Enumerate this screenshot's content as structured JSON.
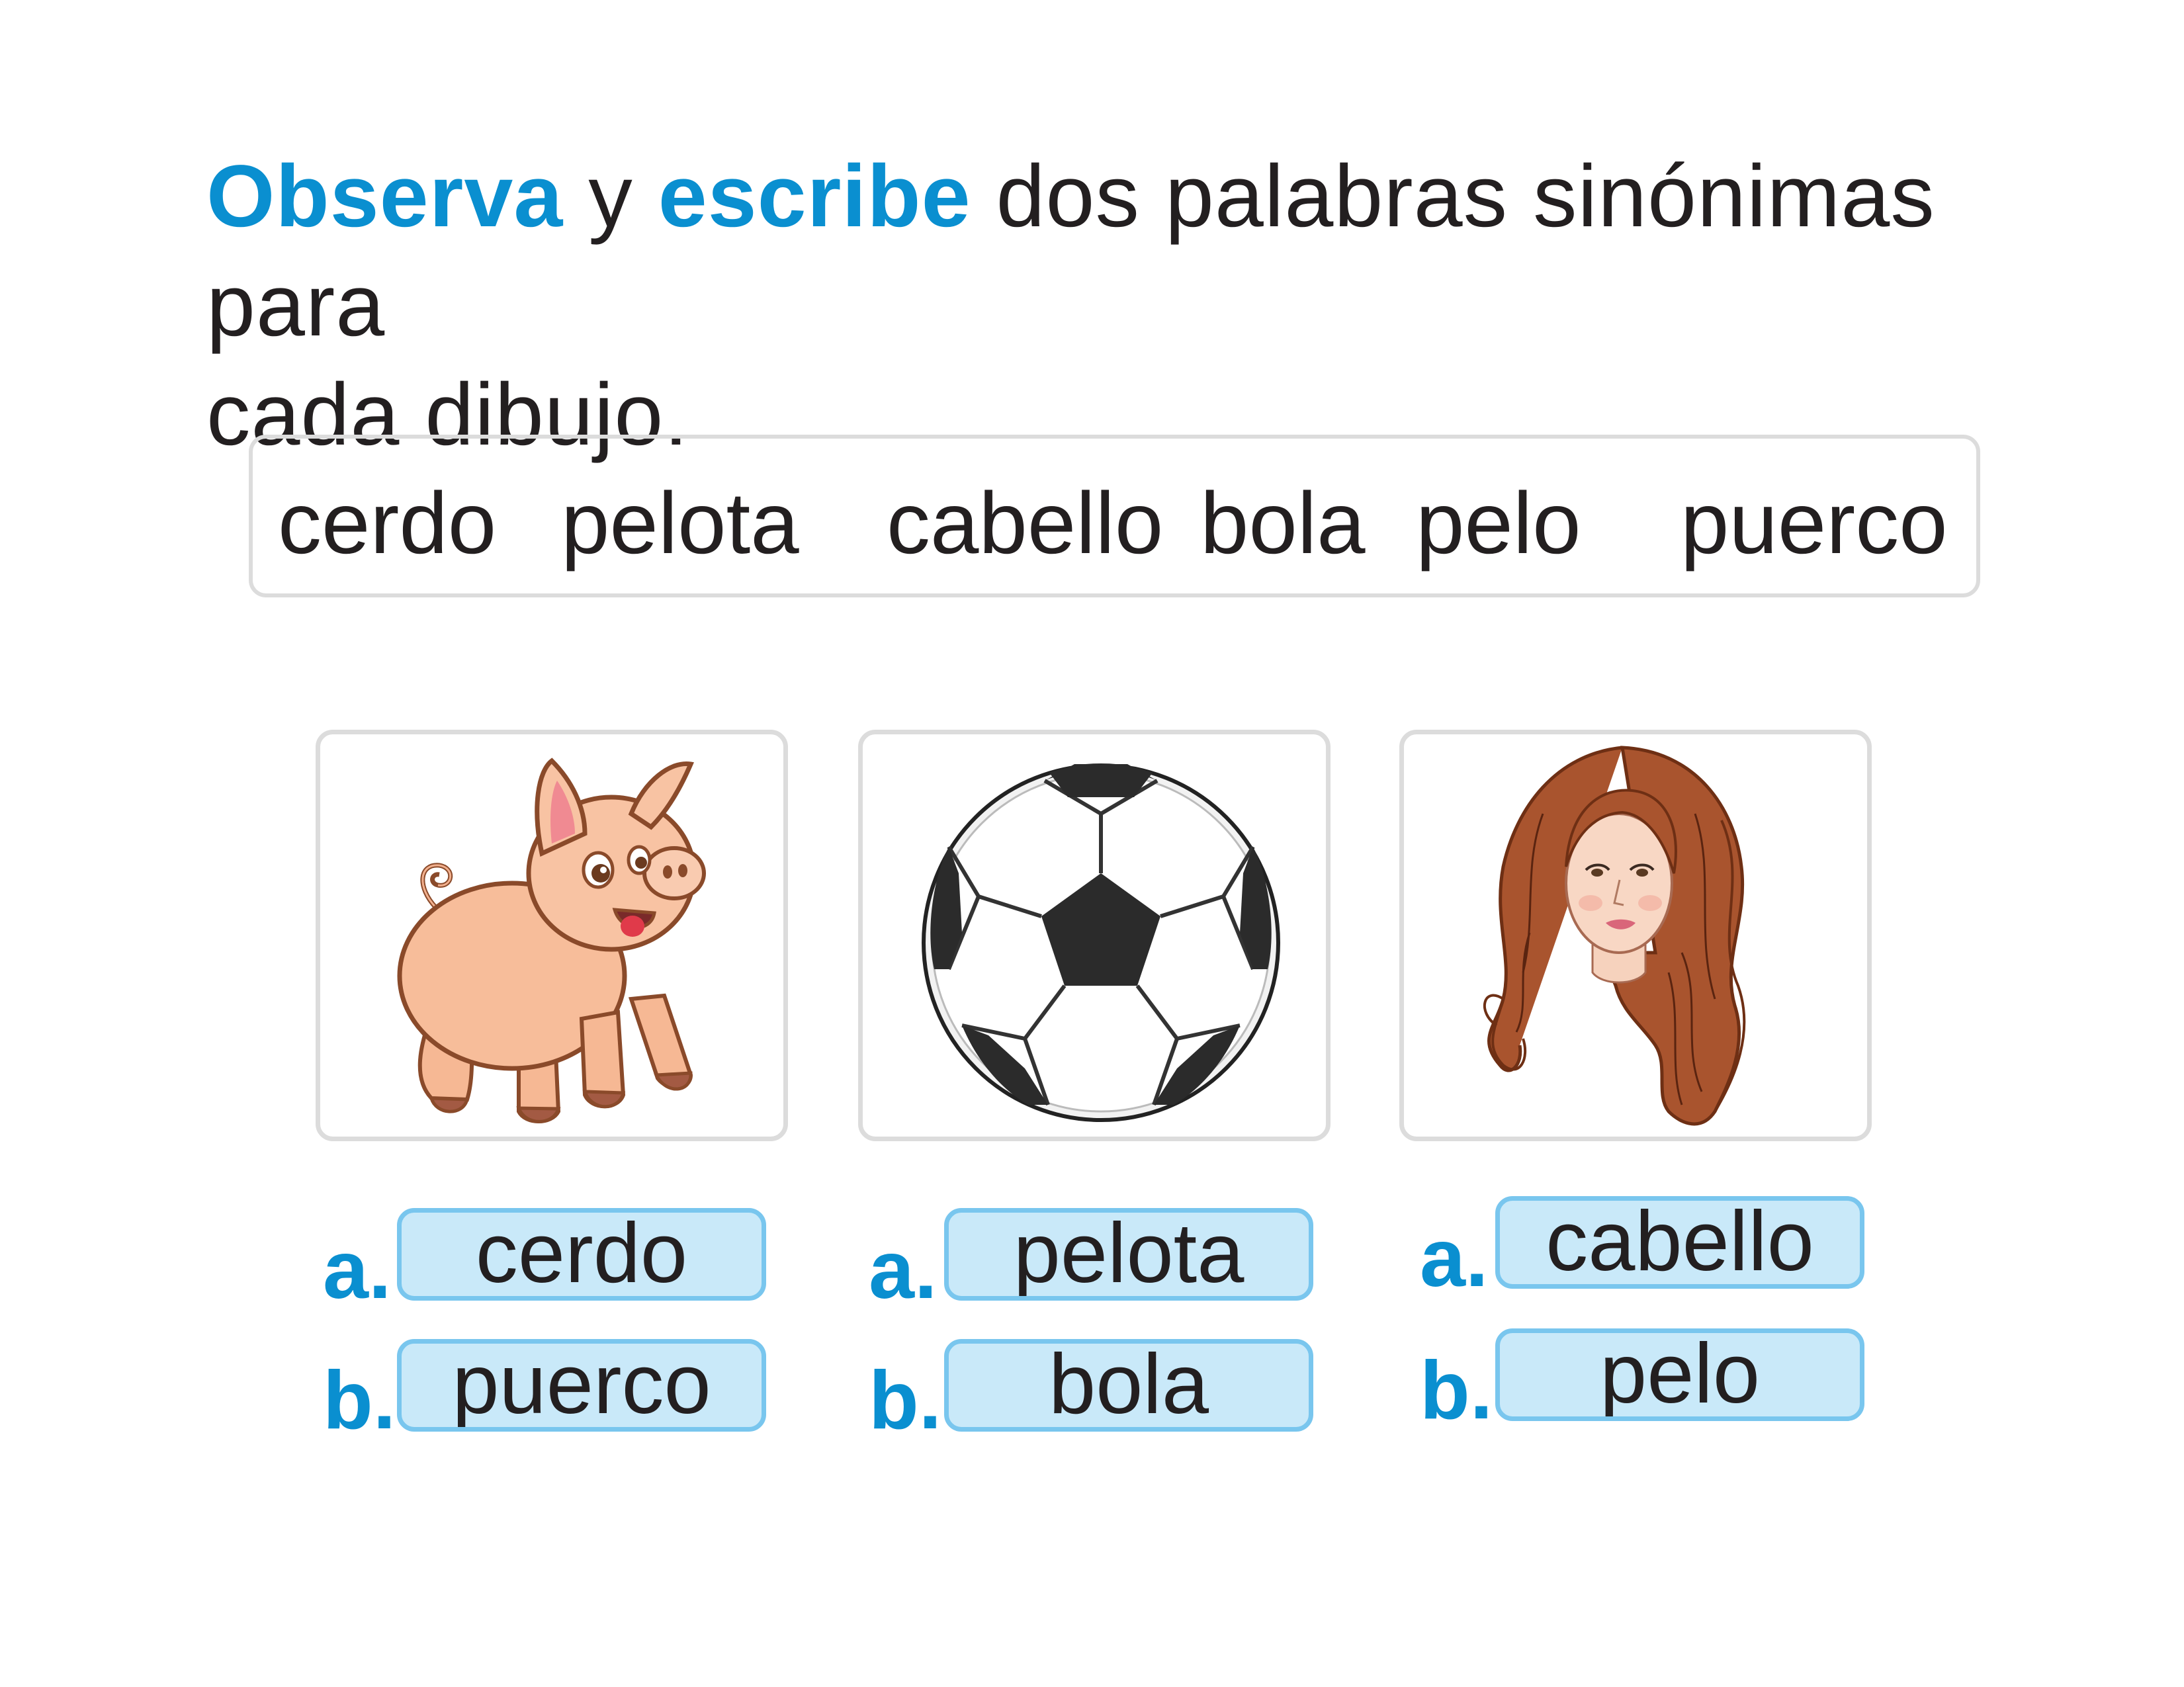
{
  "instruction": {
    "part1": "Observa",
    "part2": " y ",
    "part3": "escribe",
    "part4": " dos palabras sinónimas para",
    "part5": "cada dibujo."
  },
  "word_bank": [
    "cerdo",
    "pelota",
    "cabello",
    "bola",
    "pelo",
    "puerco"
  ],
  "items": [
    {
      "picture": "pig-illustration",
      "label_a": "a.",
      "answer_a": "cerdo",
      "label_b": "b.",
      "answer_b": "puerco"
    },
    {
      "picture": "soccer-ball-illustration",
      "label_a": "a.",
      "answer_a": "pelota",
      "label_b": "b.",
      "answer_b": "bola"
    },
    {
      "picture": "woman-hair-illustration",
      "label_a": "a.",
      "answer_a": "cabello",
      "label_b": "b.",
      "answer_b": "pelo"
    }
  ],
  "colors": {
    "accent": "#0a8fd0",
    "answer_fill": "#c9e9f9",
    "answer_border": "#79c6ee",
    "card_border": "#dcdcdc"
  }
}
